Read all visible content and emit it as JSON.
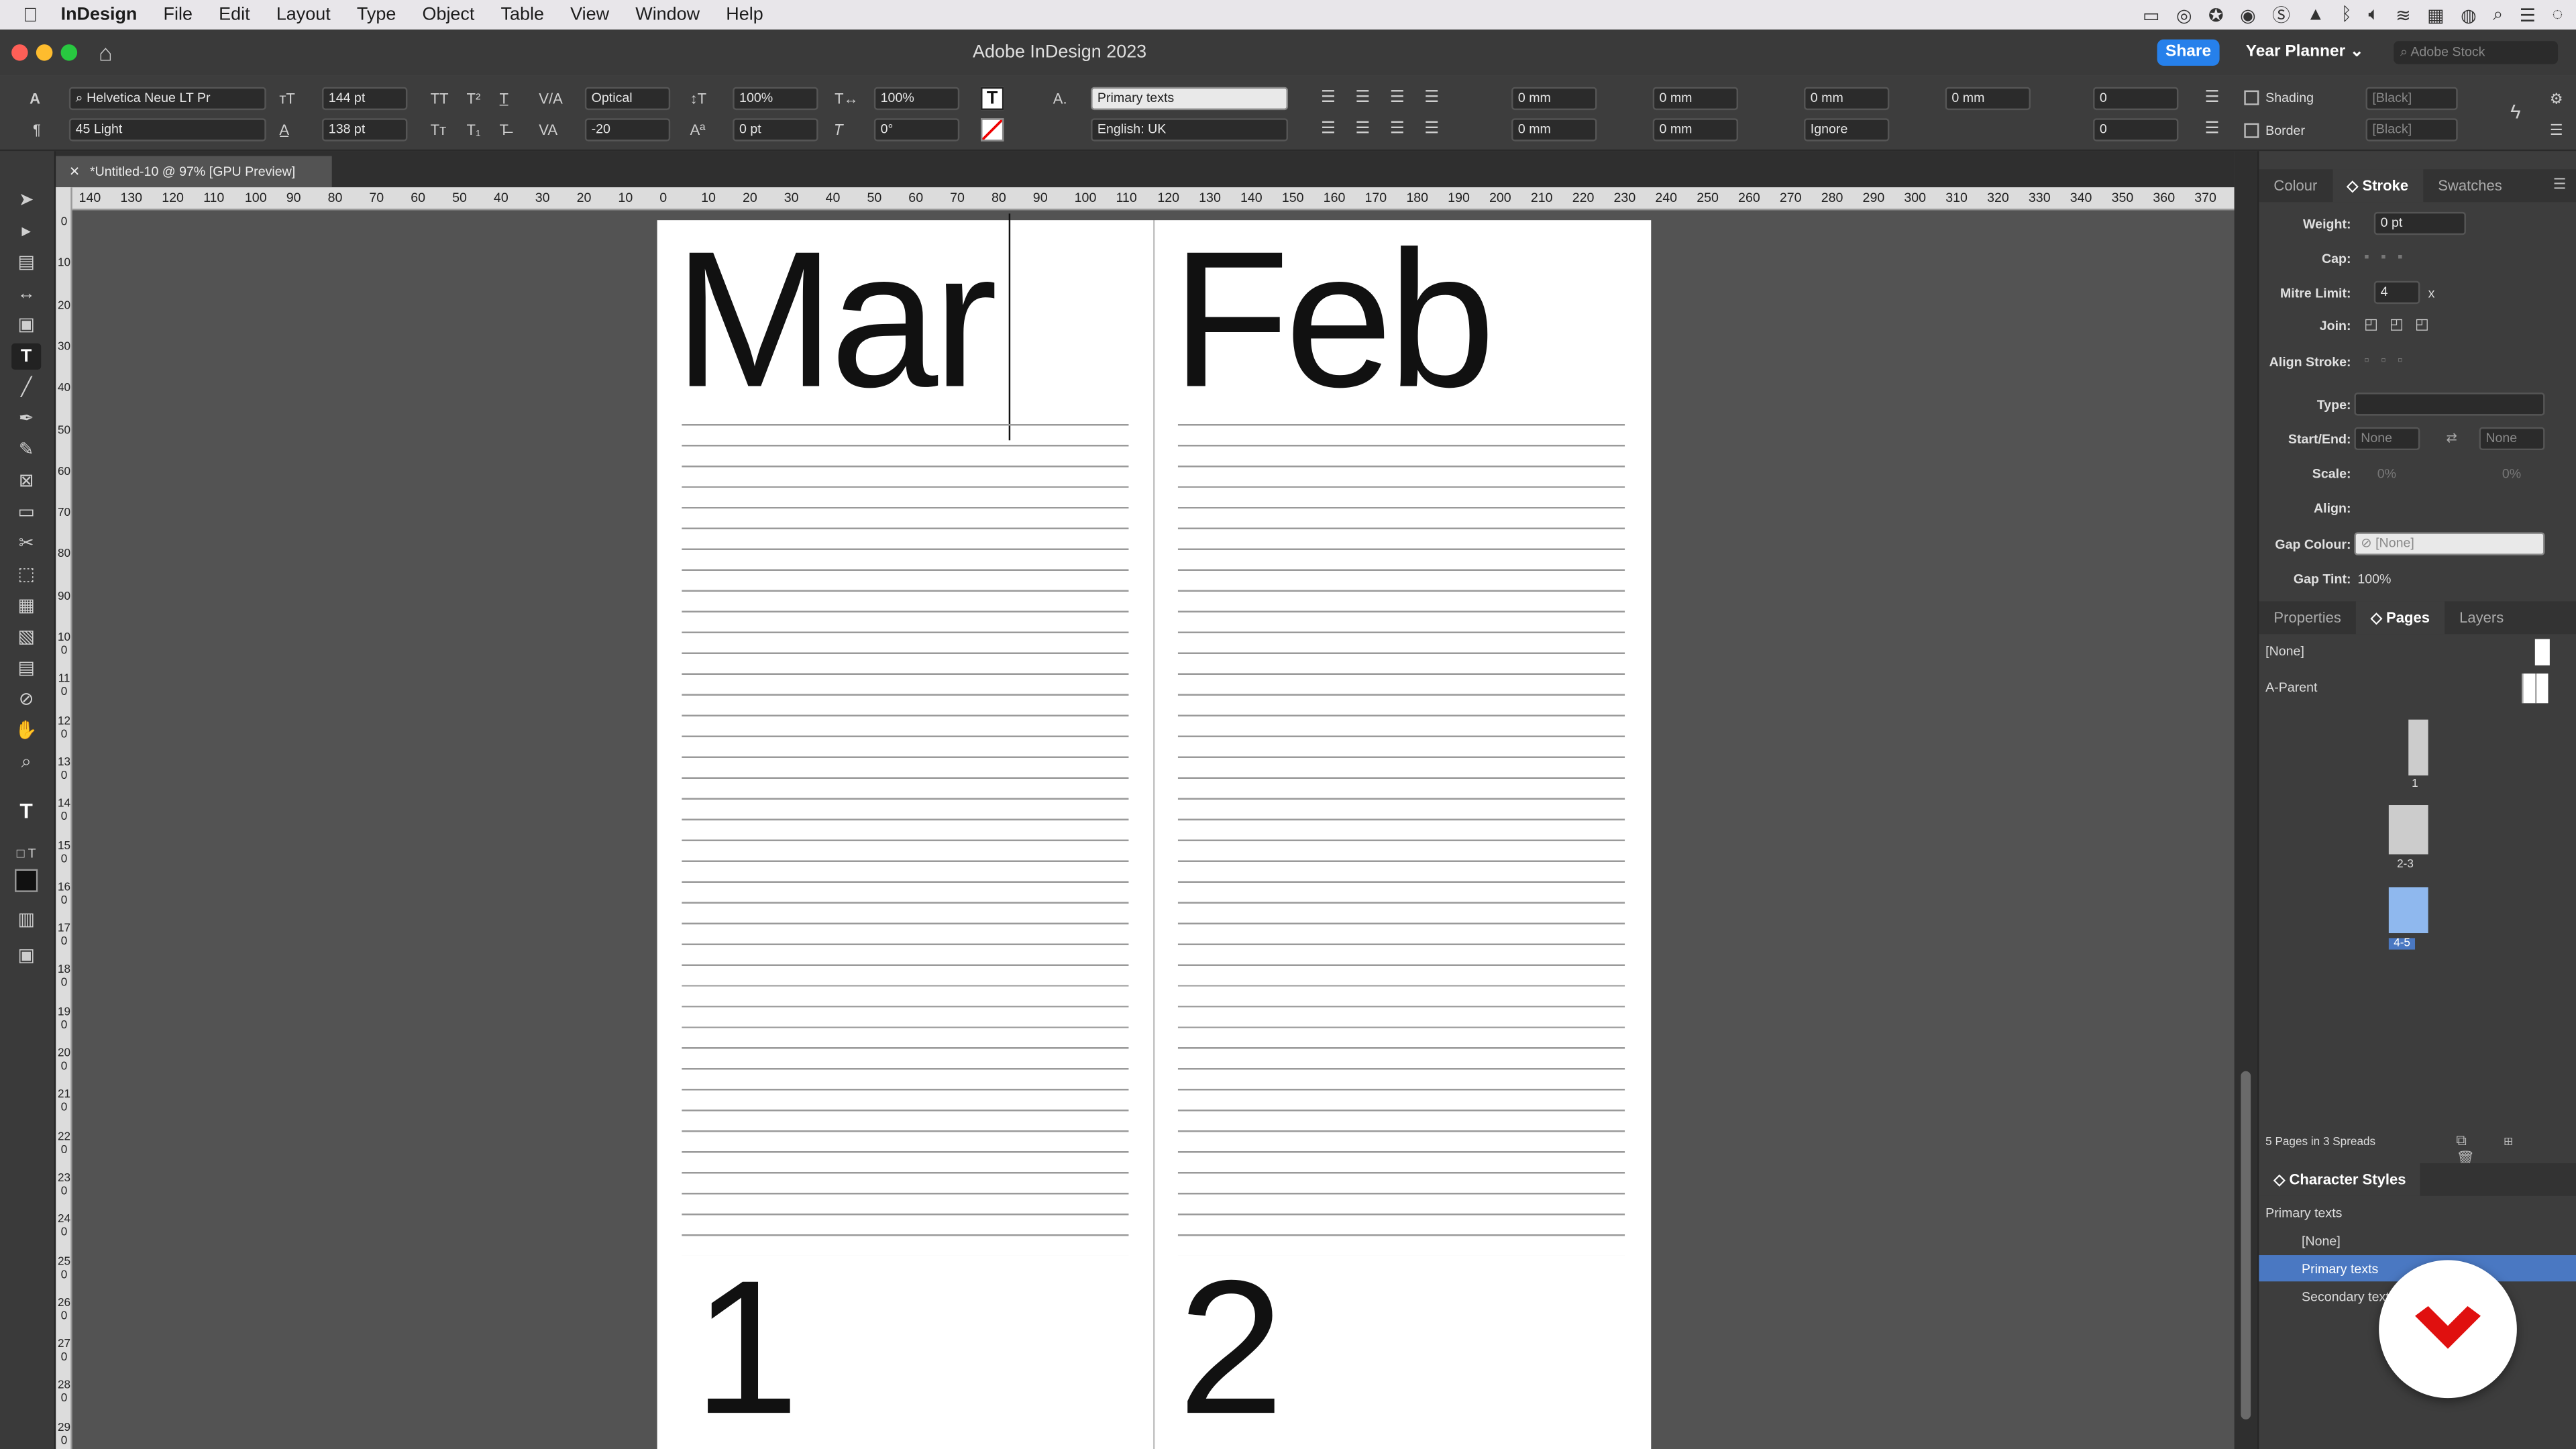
{
  "menubar": {
    "app": "InDesign",
    "items": [
      "File",
      "Edit",
      "Layout",
      "Type",
      "Object",
      "Table",
      "View",
      "Window",
      "Help"
    ]
  },
  "titlebar": {
    "title": "Adobe InDesign 2023",
    "share": "Share",
    "workspace": "Year Planner",
    "stock_placeholder": "Adobe Stock"
  },
  "control": {
    "font_family": "Helvetica Neue LT Pr",
    "font_style": "45 Light",
    "font_size": "144 pt",
    "leading": "138 pt",
    "kerning": "Optical",
    "tracking": "-20",
    "vscale": "100%",
    "hscale": "100%",
    "baseline": "0 pt",
    "skew": "0°",
    "char_style": "Primary texts",
    "language": "English: UK",
    "indent_left": "0 mm",
    "indent_right": "0 mm",
    "indent_first": "0 mm",
    "indent_last": "0 mm",
    "space_before": "0 mm",
    "space_after": "0 mm",
    "indent_extra": "0 mm",
    "ignore": "Ignore",
    "dropcap_lines": "0",
    "dropcap_chars": "0",
    "shading": "Shading",
    "border": "Border",
    "shading_color": "[Black]",
    "border_color": "[Black]"
  },
  "document": {
    "tab": "*Untitled-10 @ 97% [GPU Preview]",
    "pages": [
      {
        "month": "Mar",
        "day": "1"
      },
      {
        "month": "Feb",
        "day": "2"
      }
    ]
  },
  "ruler_h": [
    "140",
    "130",
    "120",
    "110",
    "100",
    "90",
    "80",
    "70",
    "60",
    "50",
    "40",
    "30",
    "20",
    "10",
    "0",
    "10",
    "20",
    "30",
    "40",
    "50",
    "60",
    "70",
    "80",
    "90",
    "100",
    "110",
    "120",
    "130",
    "140",
    "150",
    "160",
    "170",
    "180",
    "190",
    "200",
    "210",
    "220",
    "230",
    "240",
    "250",
    "260",
    "270",
    "280",
    "290",
    "300",
    "310",
    "320",
    "330",
    "340",
    "350",
    "360",
    "370"
  ],
  "ruler_v": [
    "0",
    "10",
    "20",
    "30",
    "40",
    "50",
    "60",
    "70",
    "80",
    "90",
    "100",
    "110",
    "120",
    "130",
    "140",
    "150",
    "160",
    "170",
    "180",
    "190",
    "200",
    "210",
    "220",
    "230",
    "240",
    "250",
    "260",
    "270",
    "280",
    "290"
  ],
  "stroke_panel": {
    "tabs": [
      "Colour",
      "Stroke",
      "Swatches"
    ],
    "weight_label": "Weight:",
    "weight": "0 pt",
    "cap_label": "Cap:",
    "mitre_label": "Mitre Limit:",
    "mitre": "4",
    "mitre_unit": "x",
    "join_label": "Join:",
    "align_label": "Align Stroke:",
    "type_label": "Type:",
    "startend_label": "Start/End:",
    "start": "None",
    "end": "None",
    "scale_label": "Scale:",
    "scale1": "0%",
    "scale2": "0%",
    "align2_label": "Align:",
    "gapcolour_label": "Gap Colour:",
    "gapcolour": "[None]",
    "gaptint_label": "Gap Tint:",
    "gaptint": "100%"
  },
  "pages_panel": {
    "tabs": [
      "Properties",
      "Pages",
      "Layers"
    ],
    "none": "[None]",
    "parent": "A-Parent",
    "spreads": [
      "1",
      "2-3",
      "4-5"
    ],
    "summary": "5 Pages in 3 Spreads"
  },
  "char_styles": {
    "title": "Character Styles",
    "current": "Primary texts",
    "items": [
      "[None]",
      "Primary texts",
      "Secondary texts"
    ]
  },
  "colors": {
    "accent": "#4a78c2",
    "share": "#2680eb",
    "brand": "#e0100f"
  }
}
